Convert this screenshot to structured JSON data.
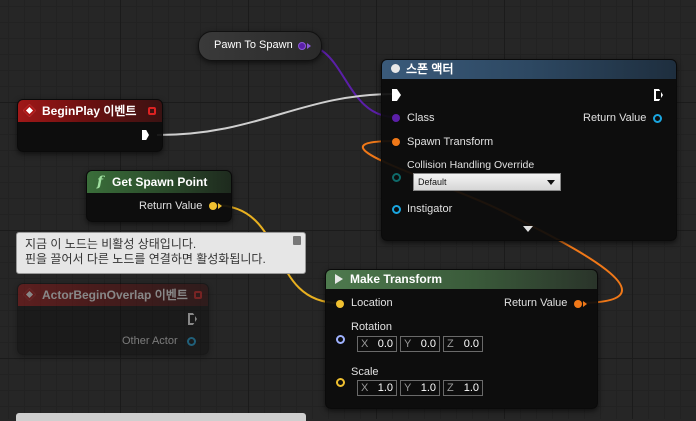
{
  "colors": {
    "background": "#262626",
    "exec_pin": "#ffffff",
    "class_pin": "#5b1fa8",
    "transform_pin": "#f07818",
    "struct_yellow": "#f0c030",
    "object_pin": "#1aa6e0",
    "rotator_pin": "#9fb2ff",
    "event_red": "#b01414"
  },
  "pawn_to_spawn": {
    "label": "Pawn To Spawn"
  },
  "begin_play": {
    "title": "BeginPlay 이벤트"
  },
  "get_spawn_point": {
    "title": "Get Spawn Point",
    "return_label": "Return Value"
  },
  "spawn_actor": {
    "title": "스폰 액터",
    "class_label": "Class",
    "spawn_transform_label": "Spawn Transform",
    "collision_label": "Collision Handling Override",
    "collision_value": "Default",
    "instigator_label": "Instigator",
    "return_label": "Return Value"
  },
  "make_transform": {
    "title": "Make Transform",
    "location_label": "Location",
    "return_label": "Return Value",
    "rotation_label": "Rotation",
    "rotation": {
      "x_axis": "X",
      "x": "0.0",
      "y_axis": "Y",
      "y": "0.0",
      "z_axis": "Z",
      "z": "0.0"
    },
    "scale_label": "Scale",
    "scale": {
      "x_axis": "X",
      "x": "1.0",
      "y_axis": "Y",
      "y": "1.0",
      "z_axis": "Z",
      "z": "1.0"
    }
  },
  "disabled_node": {
    "tooltip_line1": "지금 이 노드는 비활성 상태입니다.",
    "tooltip_line2": "핀을 끌어서 다른 노드를 연결하면 활성화됩니다.",
    "title": "ActorBeginOverlap 이벤트",
    "other_actor_label": "Other Actor"
  }
}
